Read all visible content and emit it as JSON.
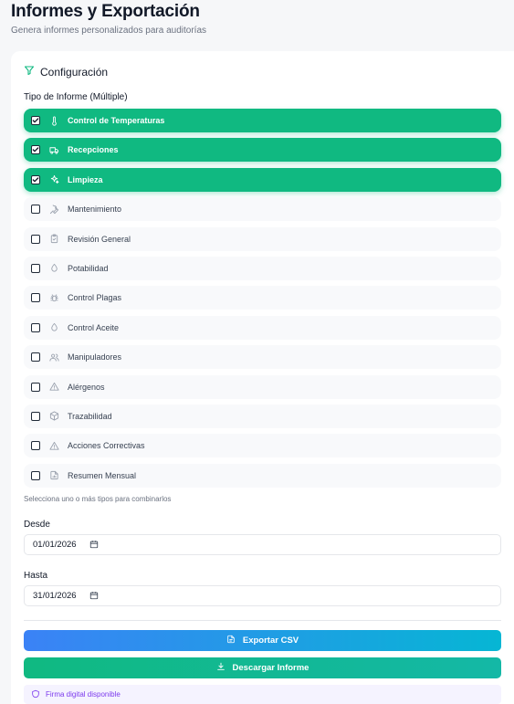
{
  "header": {
    "title": "Informes y Exportación",
    "subtitle": "Genera informes personalizados para auditorías"
  },
  "config": {
    "section_title": "Configuración",
    "type_label": "Tipo de Informe (Múltiple)",
    "options": [
      {
        "label": "Control de Temperaturas",
        "icon": "thermometer-icon",
        "checked": true
      },
      {
        "label": "Recepciones",
        "icon": "truck-icon",
        "checked": true
      },
      {
        "label": "Limpieza",
        "icon": "sparkles-icon",
        "checked": true
      },
      {
        "label": "Mantenimiento",
        "icon": "wrench-icon",
        "checked": false
      },
      {
        "label": "Revisión General",
        "icon": "clipboard-check-icon",
        "checked": false
      },
      {
        "label": "Potabilidad",
        "icon": "droplet-icon",
        "checked": false
      },
      {
        "label": "Control Plagas",
        "icon": "bug-icon",
        "checked": false
      },
      {
        "label": "Control Aceite",
        "icon": "droplet-icon",
        "checked": false
      },
      {
        "label": "Manipuladores",
        "icon": "users-icon",
        "checked": false
      },
      {
        "label": "Alérgenos",
        "icon": "alert-triangle-icon",
        "checked": false
      },
      {
        "label": "Trazabilidad",
        "icon": "package-icon",
        "checked": false
      },
      {
        "label": "Acciones Correctivas",
        "icon": "alert-triangle-icon",
        "checked": false
      },
      {
        "label": "Resumen Mensual",
        "icon": "file-chart-icon",
        "checked": false
      }
    ],
    "hint": "Selecciona uno o más tipos para combinarlos"
  },
  "dates": {
    "from_label": "Desde",
    "from_value": "01/01/2026",
    "to_label": "Hasta",
    "to_value": "31/01/2026"
  },
  "actions": {
    "export_csv": "Exportar CSV",
    "download_report": "Descargar Informe",
    "signature_note": "Firma digital disponible"
  },
  "colors": {
    "accent": "#10b981",
    "csv_gradient_start": "#3b82f6",
    "csv_gradient_end": "#06b6d4",
    "signature": "#7c3aed"
  }
}
